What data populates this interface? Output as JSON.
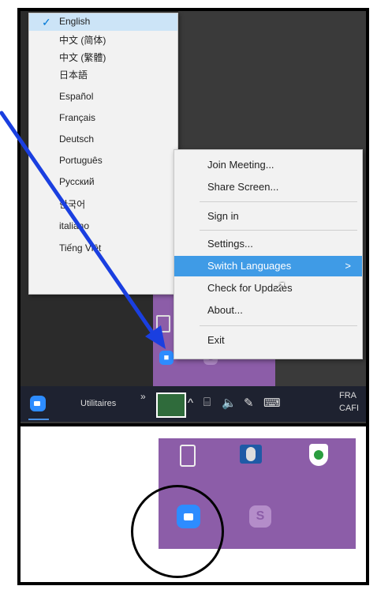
{
  "language_menu": {
    "items": [
      {
        "label": "English",
        "checked": true
      },
      {
        "label": "中文 (简体)"
      },
      {
        "label": "中文 (繁體)"
      },
      {
        "label": "日本語"
      },
      {
        "label": "Español"
      },
      {
        "label": "Français"
      },
      {
        "label": "Deutsch"
      },
      {
        "label": "Português"
      },
      {
        "label": "Русский"
      },
      {
        "label": "한국어"
      },
      {
        "label": "italiano"
      },
      {
        "label": "Tiếng Việt"
      }
    ]
  },
  "context_menu": {
    "items": [
      {
        "label": "Join Meeting..."
      },
      {
        "label": "Share Screen..."
      },
      {
        "label": "Sign in"
      },
      {
        "label": "Settings..."
      },
      {
        "label": "Switch Languages",
        "highlighted": true,
        "submenu_arrow": ">"
      },
      {
        "label": "Check for Updates"
      },
      {
        "label": "About..."
      },
      {
        "label": "Exit"
      }
    ]
  },
  "taskbar": {
    "folder_label": "Utilitaires",
    "overflow_symbol": "»",
    "chevron_symbol": "^",
    "lang_top": "FRA",
    "lang_bottom": "CAFI"
  },
  "icons": {
    "zoom": "zoom-camera-icon",
    "skype": "skype-icon",
    "usb": "usb-drive-icon",
    "mouse": "mouse-icon",
    "shield": "security-shield-icon"
  },
  "colors": {
    "highlight": "#3f9be6",
    "purple_bg": "#8c5da8",
    "arrow": "#1a3fe0",
    "zoom_blue": "#2d8cff"
  }
}
